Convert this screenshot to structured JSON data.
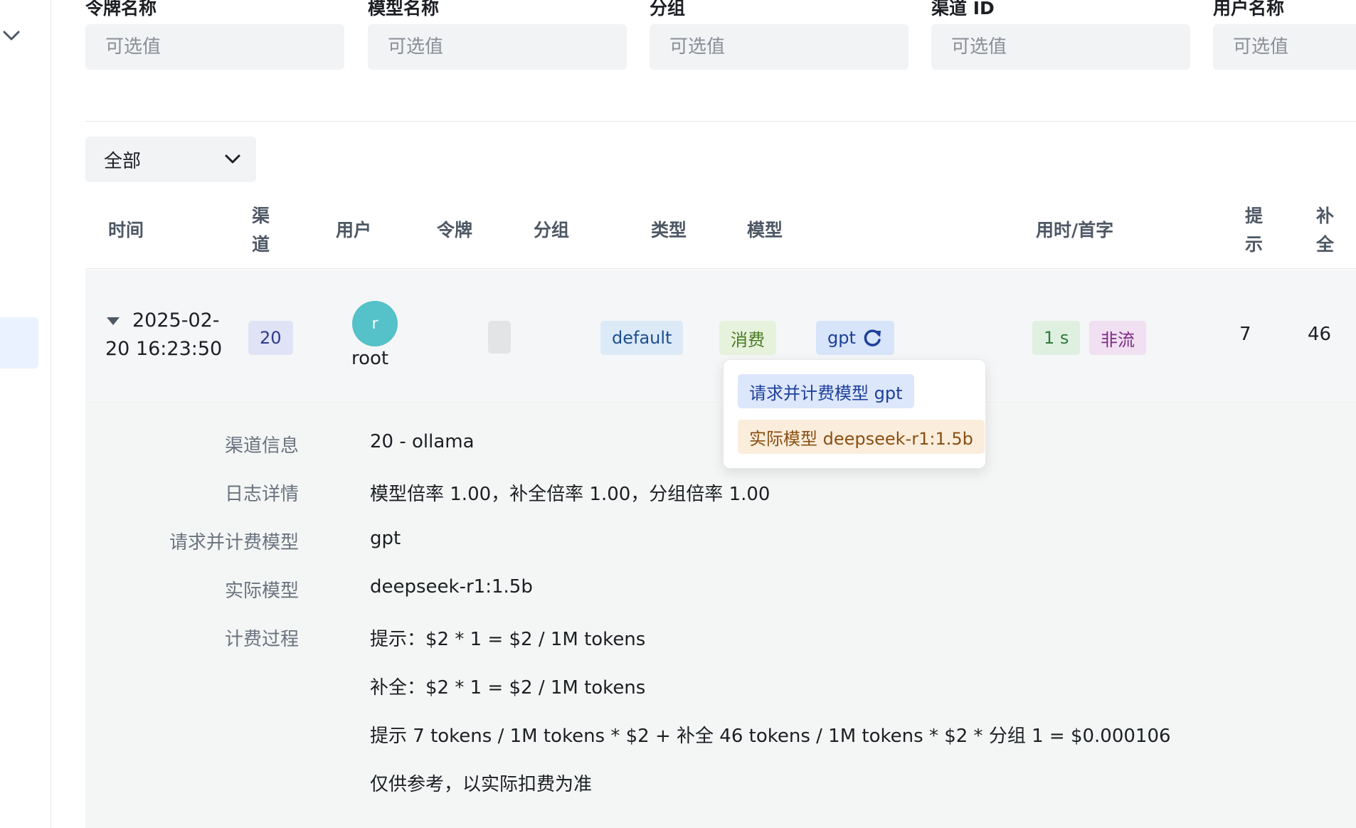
{
  "filters": [
    {
      "label": "令牌名称",
      "placeholder": "可选值"
    },
    {
      "label": "模型名称",
      "placeholder": "可选值"
    },
    {
      "label": "分组",
      "placeholder": "可选值"
    },
    {
      "label": "渠道 ID",
      "placeholder": "可选值"
    },
    {
      "label": "用户名称",
      "placeholder": "可选值"
    }
  ],
  "type_select": {
    "value": "全部"
  },
  "columns": {
    "time": "时间",
    "channel": "渠道",
    "user": "用户",
    "token": "令牌",
    "group": "分组",
    "type": "类型",
    "model": "模型",
    "duration": "用时/首字",
    "prompt": "提示",
    "completion": "补全"
  },
  "row": {
    "time": "2025-02-20 16:23:50",
    "channel": "20",
    "user_initial": "r",
    "user_name": "root",
    "group": "default",
    "type": "消费",
    "model": "gpt",
    "duration": "1 s",
    "stream": "非流",
    "prompt_tokens": "7",
    "completion_tokens": "46"
  },
  "popover": {
    "request_model": "请求并计费模型 gpt",
    "actual_model": "实际模型 deepseek-r1:1.5b"
  },
  "details": {
    "channel_info_label": "渠道信息",
    "channel_info_value": "20 - ollama",
    "log_detail_label": "日志详情",
    "log_detail_value": "模型倍率 1.00，补全倍率 1.00，分组倍率 1.00",
    "request_model_label": "请求并计费模型",
    "request_model_value": "gpt",
    "actual_model_label": "实际模型",
    "actual_model_value": "deepseek-r1:1.5b",
    "billing_label": "计费过程",
    "billing_lines": [
      "提示：$2 * 1 = $2 / 1M tokens",
      "补全：$2 * 1 = $2 / 1M tokens",
      "提示 7 tokens / 1M tokens * $2 + 补全 46 tokens / 1M tokens * $2 * 分组 1 = $0.000106",
      "仅供参考，以实际扣费为准"
    ]
  },
  "colors": {
    "channel_tag_bg": "#e0e3f5",
    "group_tag_bg": "#dce9f7",
    "type_tag_bg": "#e6f2dc",
    "model_tag_bg": "#d7e4f9",
    "duration_tag_bg": "#dff0e1",
    "stream_tag_bg": "#f1dff2",
    "request_tag_bg": "#dde7fb",
    "actual_tag_bg": "#fbeddc"
  },
  "icons": {
    "sidebar_toggle": "chevron-down-icon",
    "select_arrow": "chevron-down-icon",
    "expand": "caret-down-icon",
    "model_refresh": "refresh-icon"
  }
}
